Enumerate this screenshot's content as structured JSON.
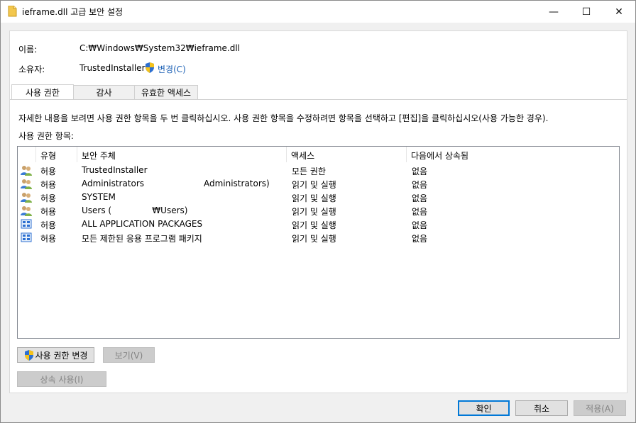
{
  "window": {
    "title": "ieframe.dll 고급 보안 설정",
    "minimize_glyph": "—",
    "maximize_glyph": "☐",
    "close_glyph": "✕"
  },
  "info": {
    "name_label": "이름:",
    "name_value": "C:₩Windows₩System32₩ieframe.dll",
    "owner_label": "소유자:",
    "owner_value": "TrustedInstaller",
    "change_link": "변경(C)"
  },
  "tabs": [
    {
      "label": "사용 권한",
      "active": true
    },
    {
      "label": "감사",
      "active": false
    },
    {
      "label": "유효한 액세스",
      "active": false
    }
  ],
  "description": "자세한 내용을 보려면 사용 권한 항목을 두 번 클릭하십시오. 사용 권한 항목을 수정하려면 항목을 선택하고 [편집]을 클릭하십시오(사용 가능한 경우).",
  "list_label": "사용 권한 항목:",
  "table": {
    "headers": [
      "유형",
      "보안 주체",
      "액세스",
      "다음에서 상속됨"
    ],
    "rows": [
      {
        "icon": "users-icon",
        "type": "허용",
        "principal": "TrustedInstaller",
        "access": "모든 권한",
        "inherited": "없음"
      },
      {
        "icon": "users-icon",
        "type": "허용",
        "principal": "Administrators                      Administrators)",
        "access": "읽기 및 실행",
        "inherited": "없음"
      },
      {
        "icon": "users-icon",
        "type": "허용",
        "principal": "SYSTEM",
        "access": "읽기 및 실행",
        "inherited": "없음"
      },
      {
        "icon": "users-icon",
        "type": "허용",
        "principal": "Users (               ₩Users)",
        "access": "읽기 및 실행",
        "inherited": "없음"
      },
      {
        "icon": "package-icon",
        "type": "허용",
        "principal": "ALL APPLICATION PACKAGES",
        "access": "읽기 및 실행",
        "inherited": "없음"
      },
      {
        "icon": "package-icon",
        "type": "허용",
        "principal": "모든 제한된 응용 프로그램 패키지",
        "access": "읽기 및 실행",
        "inherited": "없음"
      }
    ]
  },
  "buttons": {
    "change_permissions": "사용 권한 변경",
    "view": "보기(V)",
    "enable_inheritance": "상속 사용(I)",
    "ok": "확인",
    "cancel": "취소",
    "apply": "적용(A)"
  },
  "colors": {
    "link": "#1a5fb4",
    "focus": "#0078d7"
  }
}
